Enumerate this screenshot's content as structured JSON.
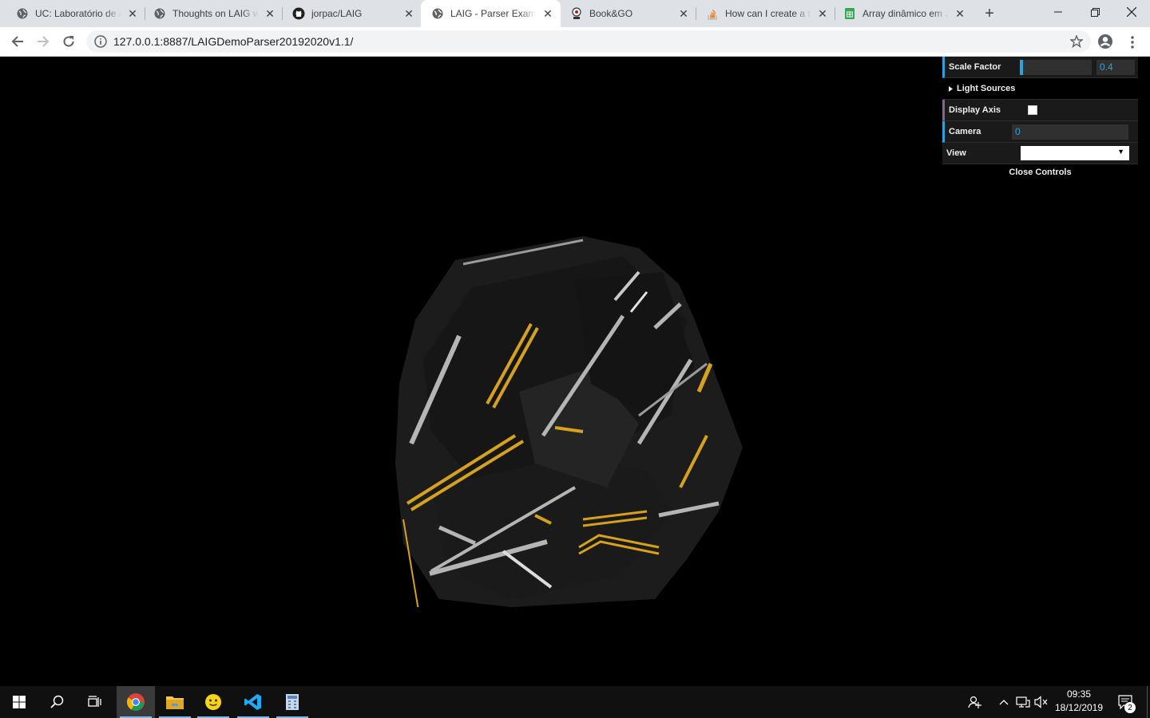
{
  "browser": {
    "tabs": [
      {
        "title": "UC: Laboratório de Aplicações",
        "icon": "globe-icon"
      },
      {
        "title": "Thoughts on LAIG work",
        "icon": "globe-icon"
      },
      {
        "title": "jorpac/LAIG",
        "icon": "github-icon"
      },
      {
        "title": "LAIG - Parser Example",
        "icon": "globe-icon",
        "active": true
      },
      {
        "title": "Book&GO",
        "icon": "bookgo-icon"
      },
      {
        "title": "How can I create a two",
        "icon": "stackoverflow-icon"
      },
      {
        "title": "Array dinâmico em Java",
        "icon": "sheets-icon"
      }
    ],
    "new_tab": "+",
    "url": "127.0.0.1:8887/LAIGDemoParser20192020v1.1/"
  },
  "gui": {
    "scale_factor_label": "Scale Factor",
    "scale_factor_value": "0.4",
    "scale_factor_fraction": 0.04,
    "light_sources_label": "Light Sources",
    "display_axis_label": "Display Axis",
    "display_axis_checked": false,
    "camera_label": "Camera",
    "camera_value": "0",
    "view_label": "View",
    "view_value": "",
    "close_controls": "Close Controls"
  },
  "taskbar": {
    "time": "09:35",
    "date": "18/12/2019",
    "notifications": "2"
  },
  "colors": {
    "accent_number": "#2fa1d6",
    "accent_bool": "#806787",
    "accent_string": "#1ed36f",
    "stripe_gold": "#d6a21e",
    "stripe_silver": "#b5b5b5"
  }
}
